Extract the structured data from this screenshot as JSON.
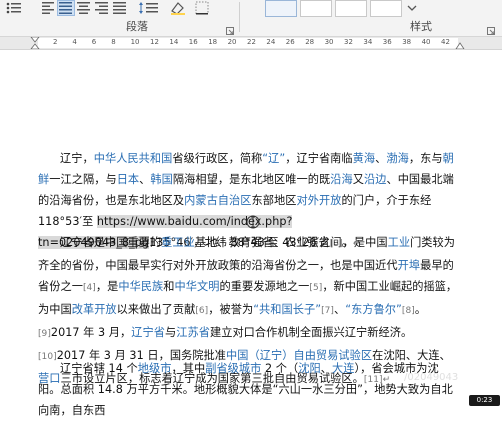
{
  "ribbon": {
    "paragraph_group_label": "段落",
    "styles_group_label": "样式"
  },
  "ruler": {
    "ticks": [
      "2",
      "4",
      "6",
      "8",
      "10",
      "12",
      "14",
      "16",
      "18",
      "20",
      "22",
      "24",
      "26",
      "28",
      "30",
      "32",
      "34",
      "36",
      "38",
      "40",
      "42"
    ]
  },
  "doc": {
    "p1": {
      "t01": "辽宁，",
      "t02": "中华人民共和国",
      "t03": "省级行政区，简称",
      "t04": "“辽”",
      "t05": "，辽宁省南临",
      "t06": "黄海",
      "t07": "、",
      "t08": "渤海",
      "t09": "，东与",
      "t10": "朝鲜",
      "t11": "一江之隔，与",
      "t12": "日本",
      "t13": "、",
      "t14": "韩国",
      "t15": "隔海相望，是东北地区唯一的既",
      "t16": "沿海",
      "t17": "又",
      "t18": "沿边",
      "t19": "、中国最北端的沿海省份，也是东北地区及",
      "t20": "内蒙古自治区",
      "t21": "东部地区",
      "t22": "对外开放",
      "t23": "的门户，介于东经 118°53′至 ",
      "t24": "https://www.baidu.com/index.php?tn=02049043_8_pg",
      "t25": "135°46′，北纬 38°43′至 43°26′之间。",
      "mark": "↵"
    },
    "p2": {
      "t01": "辽宁省是中国重要的",
      "t02": "重工业",
      "t03": "基地、教育强省、农业强省",
      "t04": "[3]",
      "t05": "，是中国",
      "t06": "工业",
      "t07": "门类较为齐全的省份，中国最早实行对外开放政策的沿海省份之一，也是中国近代",
      "t08": "开埠",
      "t09": "最早的省份之一",
      "t10": "[4]",
      "t11": "，是",
      "t12": "中华民族",
      "t13": "和",
      "t14": "中华文明",
      "t15": "的重要发源地之一",
      "t16": "[5]",
      "t17": "，新中国工业崛起的摇篮，为中国",
      "t18": "改革开放",
      "t19": "以来做出了贡献",
      "t20": "[6]",
      "t21": "，被誉为",
      "t22": "“共和国长子”",
      "t23": "[7]",
      "t24": "、",
      "t25": "“东方鲁尔”",
      "t26": "[8]",
      "t27": "。",
      "t28": "[9]",
      "t29": "2017 年 3 月，",
      "t30": "辽宁省",
      "t31": "与",
      "t32": "江苏省",
      "t33": "建立对口合作机制全面振兴辽宁新经济。",
      "t34": "[10]",
      "t35": "2017 年 3 月 31 日，国务院批准",
      "t36": "中国（辽宁）自由贸易试验区",
      "t37": "在沈阳、大连、",
      "t38": "营口",
      "t39": "三市设立片区，标志着辽宁成为国家第三批自由贸易试验区。",
      "t40": "[11]",
      "mark": "↵"
    },
    "p3": {
      "t01": "辽宁省辖 14 个",
      "t02": "地级市",
      "t03": "，其中",
      "t04": "副省级城市",
      "t05": " 2 个（",
      "t06": "沈阳",
      "t07": "、",
      "t08": "大连",
      "t09": "），省会城市为沈阳。总面积 14.8 万平方千米。地形概貌大体是“六山一水三分田”，地势大致为自北向南，自东西"
    }
  },
  "status": {
    "timer": "0:23",
    "watermark": "/02049043"
  }
}
